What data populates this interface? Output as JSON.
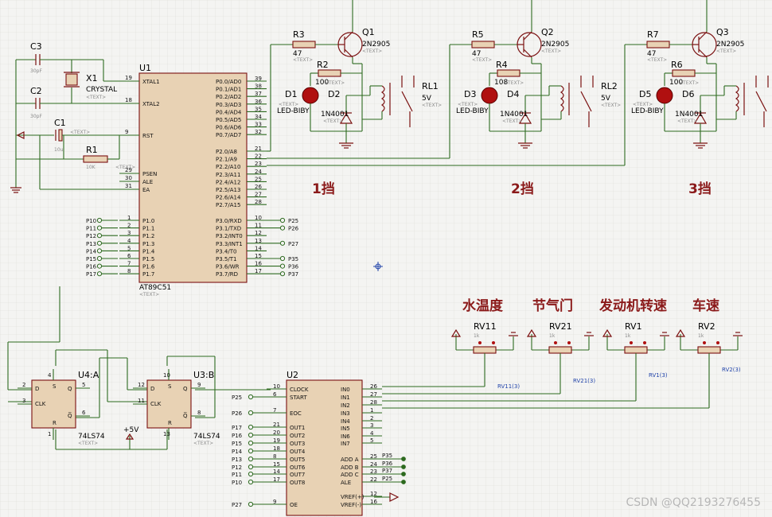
{
  "watermark": "CSDN @QQ2193276455",
  "headings": {
    "gear1": "1挡",
    "gear2": "2挡",
    "gear3": "3挡",
    "water_temp": "水温度",
    "throttle": "节气门",
    "engine_speed": "发动机转速",
    "vehicle_speed": "车速"
  },
  "parts": {
    "C3": "C3",
    "C3_val": "30pF",
    "C2": "C2",
    "C2_val": "30pF",
    "C1": "C1",
    "C1_val": "10u",
    "X1": "X1",
    "X1_type": "CRYSTAL",
    "R1": "R1",
    "R1_val": "10K",
    "U1": "U1",
    "U1_type": "AT89C51",
    "U2": "U2",
    "U3": "U3:B",
    "U4": "U4:A",
    "ic74": "74LS74",
    "R2": "R2",
    "R3": "R3",
    "R4": "R4",
    "R5": "R5",
    "R6": "R6",
    "R7": "R7",
    "r47": "47",
    "r100": "100",
    "r108": "108",
    "Q1": "Q1",
    "Q2": "Q2",
    "Q3": "Q3",
    "qtype": "2N2905",
    "D1": "D1",
    "D2": "D2",
    "D3": "D3",
    "D4": "D4",
    "D5": "D5",
    "D6": "D6",
    "led": "LED-BIBY",
    "diode": "1N4001",
    "RL1": "RL1",
    "RL2": "RL2",
    "relay_v": "5V",
    "RV11": "RV11",
    "RV21": "RV21",
    "RV1": "RV1",
    "RV2": "RV2",
    "rv_val": "1k",
    "RV11n": "RV11(3)",
    "RV21n": "RV21(3)",
    "RV1n": "RV1(3)",
    "RV2n": "RV2(3)",
    "plus5v": "+5V",
    "text_ph": "<TEXT>"
  },
  "u1_left_top": [
    {
      "n": "19",
      "s": "XTAL1"
    },
    {
      "n": "18",
      "s": "XTAL2"
    },
    {
      "n": "9",
      "s": "RST"
    },
    {
      "n": "29",
      "s": "PSEN"
    },
    {
      "n": "30",
      "s": "ALE"
    },
    {
      "n": "31",
      "s": "EA"
    }
  ],
  "u1_left_p1": [
    {
      "net": "P10",
      "n": "1",
      "s": "P1.0"
    },
    {
      "net": "P11",
      "n": "2",
      "s": "P1.1"
    },
    {
      "net": "P12",
      "n": "3",
      "s": "P1.2"
    },
    {
      "net": "P13",
      "n": "4",
      "s": "P1.3"
    },
    {
      "net": "P14",
      "n": "5",
      "s": "P1.4"
    },
    {
      "net": "P15",
      "n": "6",
      "s": "P1.5"
    },
    {
      "net": "P16",
      "n": "7",
      "s": "P1.6"
    },
    {
      "net": "P17",
      "n": "8",
      "s": "P1.7"
    }
  ],
  "u1_right_p0": [
    {
      "n": "39",
      "s": "P0.0/AD0"
    },
    {
      "n": "38",
      "s": "P0.1/AD1"
    },
    {
      "n": "37",
      "s": "P0.2/AD2"
    },
    {
      "n": "36",
      "s": "P0.3/AD3"
    },
    {
      "n": "35",
      "s": "P0.4/AD4"
    },
    {
      "n": "34",
      "s": "P0.5/AD5"
    },
    {
      "n": "33",
      "s": "P0.6/AD6"
    },
    {
      "n": "32",
      "s": "P0.7/AD7"
    }
  ],
  "u1_right_p2": [
    {
      "n": "21",
      "s": "P2.0/A8"
    },
    {
      "n": "22",
      "s": "P2.1/A9"
    },
    {
      "n": "23",
      "s": "P2.2/A10"
    },
    {
      "n": "24",
      "s": "P2.3/A11"
    },
    {
      "n": "25",
      "s": "P2.4/A12"
    },
    {
      "n": "26",
      "s": "P2.5/A13"
    },
    {
      "n": "27",
      "s": "P2.6/A14"
    },
    {
      "n": "28",
      "s": "P2.7/A15"
    }
  ],
  "u1_right_p3": [
    {
      "n": "10",
      "s": "P3.0/RXD",
      "net": "P25"
    },
    {
      "n": "11",
      "s": "P3.1/TXD",
      "net": "P26"
    },
    {
      "n": "12",
      "s": "P3.2/INT0",
      "net": ""
    },
    {
      "n": "13",
      "s": "P3.3/INT1",
      "net": "P27"
    },
    {
      "n": "14",
      "s": "P3.4/T0",
      "net": ""
    },
    {
      "n": "15",
      "s": "P3.5/T1",
      "net": "P35"
    },
    {
      "n": "16",
      "s": "P3.6/WR",
      "net": "P36"
    },
    {
      "n": "17",
      "s": "P3.7/RD",
      "net": "P37"
    }
  ],
  "u2_left": [
    {
      "net": "",
      "n": "10",
      "s": "CLOCK"
    },
    {
      "net": "P25",
      "n": "6",
      "s": "START"
    },
    {
      "net": "P26",
      "n": "7",
      "s": "EOC"
    },
    {
      "net": "P17",
      "n": "21",
      "s": "OUT1"
    },
    {
      "net": "P16",
      "n": "20",
      "s": "OUT2"
    },
    {
      "net": "P15",
      "n": "19",
      "s": "OUT3"
    },
    {
      "net": "P14",
      "n": "18",
      "s": "OUT4"
    },
    {
      "net": "P13",
      "n": "8",
      "s": "OUT5"
    },
    {
      "net": "P12",
      "n": "15",
      "s": "OUT6"
    },
    {
      "net": "P11",
      "n": "14",
      "s": "OUT7"
    },
    {
      "net": "P10",
      "n": "17",
      "s": "OUT8"
    },
    {
      "net": "P27",
      "n": "9",
      "s": "OE"
    }
  ],
  "u2_right": [
    {
      "n": "26",
      "s": "IN0",
      "net": ""
    },
    {
      "n": "27",
      "s": "IN1",
      "net": ""
    },
    {
      "n": "28",
      "s": "IN2",
      "net": ""
    },
    {
      "n": "1",
      "s": "IN3",
      "net": ""
    },
    {
      "n": "2",
      "s": "IN4",
      "net": ""
    },
    {
      "n": "3",
      "s": "IN5",
      "net": ""
    },
    {
      "n": "4",
      "s": "IN6",
      "net": ""
    },
    {
      "n": "5",
      "s": "IN7",
      "net": ""
    },
    {
      "n": "25",
      "s": "ADD A",
      "net": "P35"
    },
    {
      "n": "24",
      "s": "ADD B",
      "net": "P36"
    },
    {
      "n": "23",
      "s": "ADD C",
      "net": "P37"
    },
    {
      "n": "22",
      "s": "ALE",
      "net": "P25"
    },
    {
      "n": "12",
      "s": "VREF(+)",
      "net": ""
    },
    {
      "n": "16",
      "s": "VREF(-)",
      "net": ""
    }
  ],
  "ff_pins": {
    "D": "D",
    "S": "S",
    "Q": "Q",
    "CLK": "CLK",
    "R": "R",
    "QN": "Q̅"
  },
  "ff4_nums": {
    "d": "2",
    "s": "4",
    "q": "5",
    "clk": "3",
    "qn": "6",
    "r": "1"
  },
  "ff3_nums": {
    "d": "12",
    "s": "10",
    "q": "9",
    "clk": "11",
    "qn": "8",
    "r": "13"
  }
}
